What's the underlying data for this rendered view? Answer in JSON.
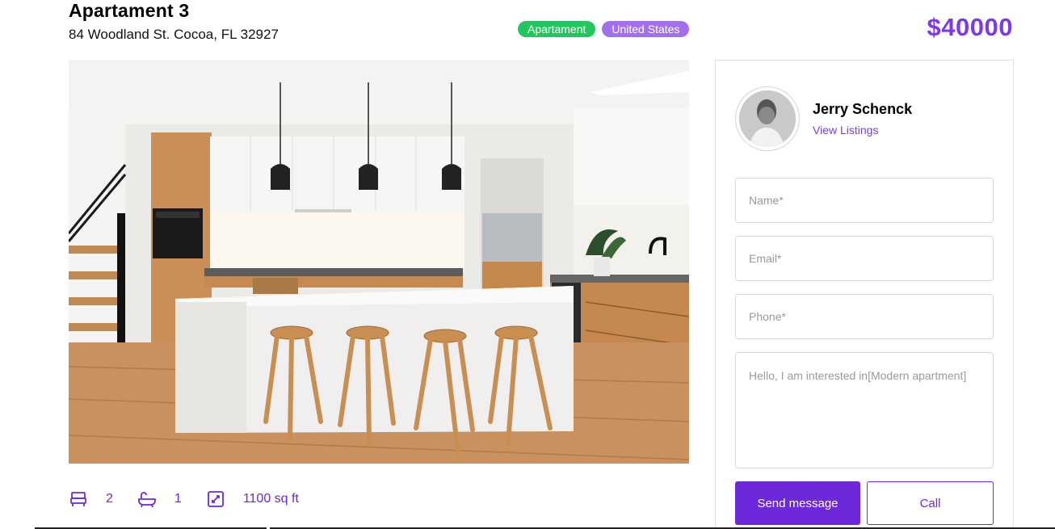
{
  "listing": {
    "title": "Apartament 3",
    "address": "84 Woodland St. Cocoa, FL 32927",
    "price": "$40000",
    "tags": [
      {
        "label": "Apartament",
        "color": "#22c55e"
      },
      {
        "label": "United States",
        "color": "#a270ef"
      }
    ],
    "features": [
      {
        "icon": "bed-icon",
        "value": "2"
      },
      {
        "icon": "bathtub-icon",
        "value": "1"
      },
      {
        "icon": "area-icon",
        "value": "1100 sq ft"
      }
    ]
  },
  "agent": {
    "name": "Jerry Schenck",
    "link_label": "View Listings"
  },
  "form": {
    "name_placeholder": "Name*",
    "email_placeholder": "Email*",
    "phone_placeholder": "Phone*",
    "message_value": "Hello, I am interested in[Modern apartment]",
    "send_label": "Send message",
    "call_label": "Call"
  },
  "colors": {
    "accent": "#6d28d9",
    "price": "#7c3aed",
    "tag_green": "#22c55e",
    "tag_purple": "#a270ef"
  }
}
